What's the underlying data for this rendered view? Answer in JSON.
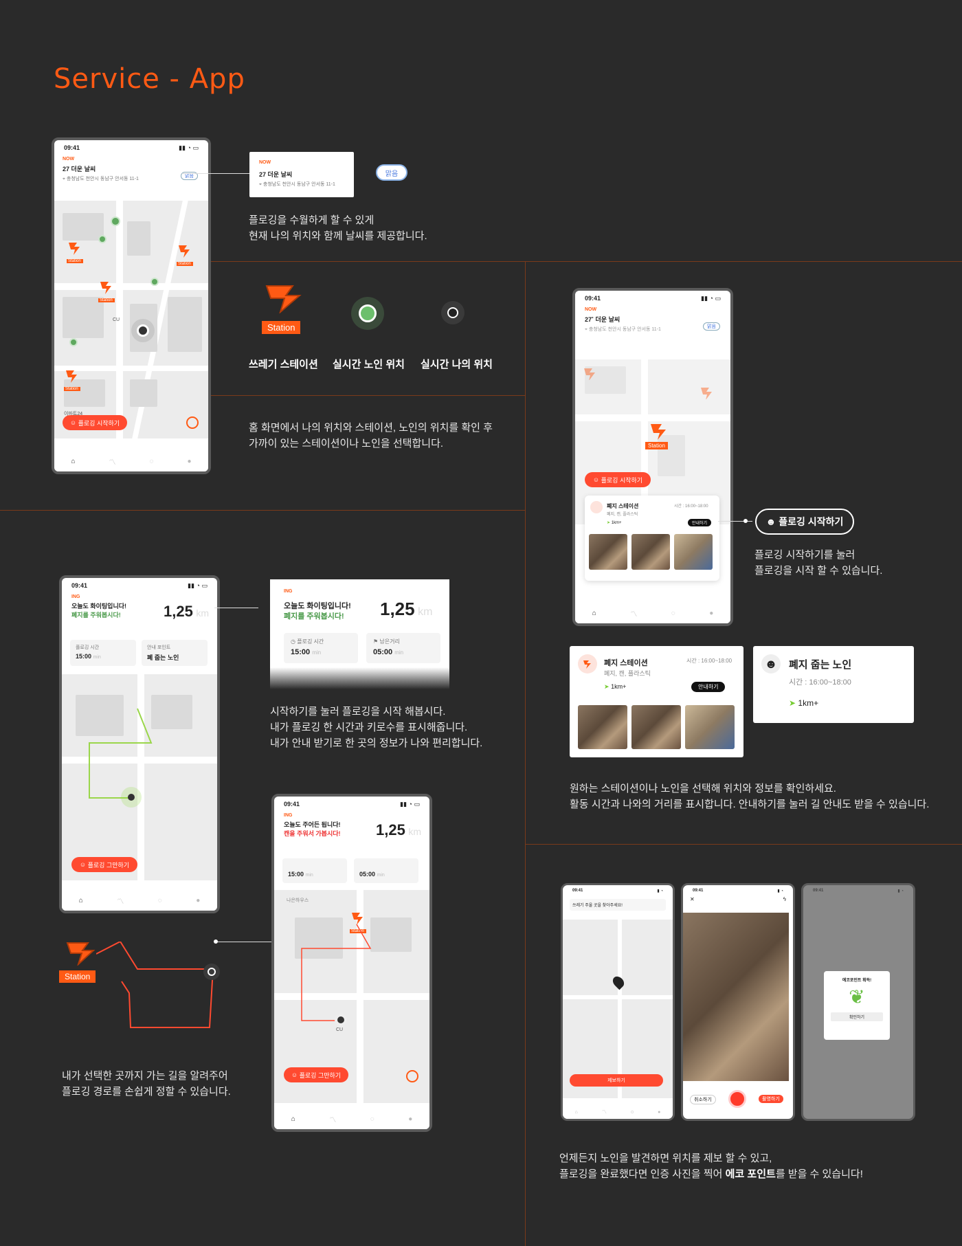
{
  "page_title": "Service - App",
  "section1": {
    "phone": {
      "time": "09:41",
      "now_label": "NOW",
      "weather": "27 더운 날씨",
      "address": "충청남도 천안시 동남구 안서동 11-1",
      "weather_badge": "맑음",
      "start_button": "플로깅 시작하기",
      "map_labels": [
        "Station",
        "Station",
        "Station",
        "Station",
        "CU",
        "이마트24"
      ]
    },
    "popup": {
      "now_label": "NOW",
      "weather": "27 더운 날씨",
      "address": "충청남도 천안시 동남구 안서동 11-1"
    },
    "badge": "맑음",
    "desc1": "플로깅을 수월하게 할 수 있게\n현재 나의 위치와 함께 날씨를 제공합니다.",
    "legend": [
      {
        "label": "쓰레기 스테이션",
        "tag": "Station"
      },
      {
        "label": "실시간 노인 위치"
      },
      {
        "label": "실시간 나의 위치"
      }
    ],
    "desc2": "홈 화면에서 나의 위치와 스테이션, 노인의 위치를 확인 후\n가까이 있는 스테이션이나 노인을 선택합니다."
  },
  "section2": {
    "phone": {
      "time": "09:41",
      "now_label": "NOW",
      "weather": "27˚ 더운 날씨",
      "address": "충청남도 천안시 동남구 안서동 11-1",
      "badge": "맑음",
      "start_button": "플로깅 시작하기",
      "station_tag": "Station",
      "card_title": "폐지 스테이션",
      "card_sub": "폐지, 캔, 플라스틱",
      "card_time": "시간 : 16:00~18:00",
      "card_dist": "1km+",
      "card_btn": "안내하기"
    },
    "callout_button": "플로깅 시작하기",
    "desc": "플로깅 시작하기를 눌러\n플로깅을 시작 할 수 있습니다.",
    "station_card": {
      "title": "폐지 스테이션",
      "sub": "폐지, 캔, 플라스틱",
      "time": "시간 : 16:00~18:00",
      "dist": "1km+",
      "btn": "안내하기"
    },
    "elder_card": {
      "title": "폐지 줍는 노인",
      "time": "시간 : 16:00~18:00",
      "dist": "1km+"
    },
    "desc2": "원하는 스테이션이나 노인을 선택해 위치와 정보를 확인하세요.\n활동 시간과 나와의 거리를 표시합니다. 안내하기를 눌러 길 안내도 받을 수 있습니다."
  },
  "section3": {
    "phone": {
      "time": "09:41",
      "ing": "ING",
      "line1": "오늘도 화이팅입니다!",
      "line2": "폐지를 주워봅시다!",
      "distance": "1,25",
      "unit": "km",
      "stat1_label": "플로깅 시간",
      "stat1_value": "15:00",
      "stat1_unit": "min",
      "stat2_label": "안내 포인트",
      "stat2_value": "폐 줍는 노인",
      "end_button": "플로깅 그만하기"
    },
    "popup": {
      "ing": "ING",
      "line1": "오늘도 화이팅입니다!",
      "line2": "폐지를 주워봅시다!",
      "distance": "1,25",
      "unit": "km",
      "stat1_label": "플로깅 시간",
      "stat1_value": "15:00",
      "stat1_unit": "min",
      "stat2_label": "남은거리",
      "stat2_value": "05:00",
      "stat2_unit": "min"
    },
    "desc1": "시작하기를 눌러 플로깅을 시작 해봅시다.\n내가 플로깅 한 시간과 키로수를 표시해줍니다.\n내가 안내 받기로 한 곳의 정보가 나와 편리합니다.",
    "route_tag": "Station",
    "desc2": "내가 선택한 곳까지 가는 길을 알려주어\n플로깅 경로를 손쉽게 정할 수 있습니다.",
    "phone2": {
      "time": "09:41",
      "ing": "ING",
      "line1": "오늘도 주어든 됩니다!",
      "line2": "캔을 주워서 가봅시다!",
      "distance": "1,25",
      "unit": "km",
      "stat1_value": "15:00",
      "stat1_unit": "min",
      "stat2_value": "05:00",
      "stat2_unit": "min",
      "end_button": "플로깅 그만하기",
      "map_labels": [
        "나은하우스",
        "CU",
        "Station"
      ]
    }
  },
  "section4": {
    "phones": [
      {
        "time": "09:41",
        "banner": "쓰레기 주울 곳을 찾아주세요!",
        "button": "제보하기"
      },
      {
        "time": "09:41",
        "left": "취소하기",
        "right": "촬영하기"
      },
      {
        "time": "09:41",
        "modal_title": "에코포인트 획득!",
        "modal_btn": "확인하기"
      }
    ],
    "desc_part1": "언제든지 노인을 발견하면 위치를 제보 할 수 있고,\n플로깅을 완료했다면 인증 사진을 찍어 ",
    "desc_bold": "에코 포인트",
    "desc_part2": "를 받을 수 있습니다!"
  },
  "colors": {
    "accent": "#ff5a14",
    "background": "#2a2a2a",
    "green": "#5fa85f",
    "line": "#7a3a1a"
  }
}
